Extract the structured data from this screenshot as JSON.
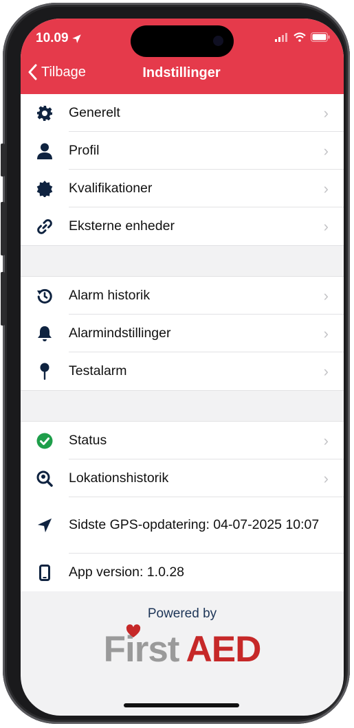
{
  "status_bar": {
    "time": "10.09"
  },
  "nav": {
    "back_label": "Tilbage",
    "title": "Indstillinger"
  },
  "groups": [
    {
      "items": [
        {
          "label": "Generelt",
          "icon": "gear-icon"
        },
        {
          "label": "Profil",
          "icon": "user-icon"
        },
        {
          "label": "Kvalifikationer",
          "icon": "certificate-icon"
        },
        {
          "label": "Eksterne enheder",
          "icon": "link-icon"
        }
      ]
    },
    {
      "items": [
        {
          "label": "Alarm historik",
          "icon": "history-icon"
        },
        {
          "label": "Alarmindstillinger",
          "icon": "bell-icon"
        },
        {
          "label": "Testalarm",
          "icon": "pin-icon"
        }
      ]
    },
    {
      "items": [
        {
          "label": "Status",
          "icon": "check-circle-icon"
        },
        {
          "label": "Lokationshistorik",
          "icon": "search-location-icon"
        },
        {
          "label": "Sidste GPS-opdatering: 04-07-2025 10:07",
          "icon": "location-arrow-icon"
        },
        {
          "label": "App version: 1.0.28",
          "icon": "phone-icon"
        }
      ]
    }
  ],
  "footer": {
    "powered_by": "Powered by",
    "logo_first": "First",
    "logo_aed": "AED"
  },
  "colors": {
    "header": "#e53a4b",
    "icon": "#0f2340",
    "status_ok": "#1e9e4a",
    "logo_red": "#c62828",
    "logo_gray": "#9a9a9a"
  }
}
